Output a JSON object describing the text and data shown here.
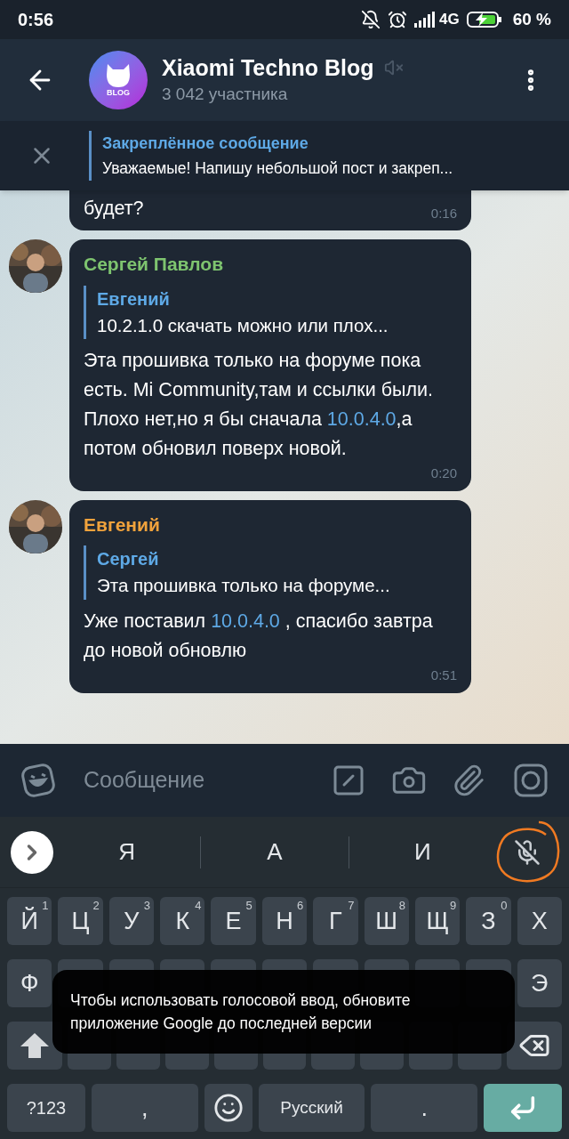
{
  "status_bar": {
    "time": "0:56",
    "network": "4G",
    "battery": "60 %",
    "charging": true
  },
  "header": {
    "title": "Xiaomi Techno Blog",
    "avatar_text": "BLOG",
    "muted": true,
    "subtitle": "3 042 участника"
  },
  "pinned": {
    "label": "Закреплённое сообщение",
    "text": "Уважаемые! Напишу небольшой пост и закреп..."
  },
  "messages": [
    {
      "kind": "cut",
      "body": [
        {
          "text": "будет?",
          "link": false
        }
      ],
      "time": "0:16"
    },
    {
      "kind": "reply",
      "sender": "Сергей Павлов",
      "color": "#7ec46f",
      "reply": {
        "author": "Евгений",
        "text": "10.2.1.0 скачать можно или плох..."
      },
      "body": [
        {
          "text": "Эта прошивка только на форуме пока есть. Mi Community,там и ссылки были. Плохо нет,но я бы сначала ",
          "link": false
        },
        {
          "text": "10.0.4.0",
          "link": true
        },
        {
          "text": ",а потом обновил поверх новой.",
          "link": false
        }
      ],
      "time": "0:20"
    },
    {
      "kind": "reply",
      "sender": "Евгений",
      "color": "#f0a23c",
      "reply": {
        "author": "Сергей",
        "text": "Эта прошивка только на форуме..."
      },
      "body": [
        {
          "text": "Уже поставил ",
          "link": false
        },
        {
          "text": "10.0.4.0",
          "link": true
        },
        {
          "text": " , спасибо завтра до новой обновлю",
          "link": false
        }
      ],
      "time": "0:51"
    }
  ],
  "composer": {
    "placeholder": "Сообщение"
  },
  "suggestions": [
    "Я",
    "А",
    "И"
  ],
  "voice_disabled": true,
  "keyboard_rows": [
    [
      {
        "kind": "letter",
        "label": "Й",
        "hint": "1"
      },
      {
        "kind": "letter",
        "label": "Ц",
        "hint": "2"
      },
      {
        "kind": "letter",
        "label": "У",
        "hint": "3"
      },
      {
        "kind": "letter",
        "label": "К",
        "hint": "4"
      },
      {
        "kind": "letter",
        "label": "Е",
        "hint": "5"
      },
      {
        "kind": "letter",
        "label": "Н",
        "hint": "6"
      },
      {
        "kind": "letter",
        "label": "Г",
        "hint": "7"
      },
      {
        "kind": "letter",
        "label": "Ш",
        "hint": "8"
      },
      {
        "kind": "letter",
        "label": "Щ",
        "hint": "9"
      },
      {
        "kind": "letter",
        "label": "З",
        "hint": "0"
      },
      {
        "kind": "letter",
        "label": "Х"
      }
    ],
    [
      {
        "kind": "letter",
        "label": "Ф"
      },
      {
        "kind": "blank"
      },
      {
        "kind": "blank"
      },
      {
        "kind": "blank"
      },
      {
        "kind": "blank"
      },
      {
        "kind": "blank"
      },
      {
        "kind": "blank"
      },
      {
        "kind": "blank"
      },
      {
        "kind": "blank"
      },
      {
        "kind": "blank"
      },
      {
        "kind": "letter",
        "label": "Э"
      }
    ],
    [
      {
        "kind": "shift"
      },
      {
        "kind": "blank"
      },
      {
        "kind": "blank"
      },
      {
        "kind": "blank"
      },
      {
        "kind": "blank"
      },
      {
        "kind": "blank"
      },
      {
        "kind": "blank"
      },
      {
        "kind": "blank"
      },
      {
        "kind": "blank"
      },
      {
        "kind": "blank"
      },
      {
        "kind": "backspace"
      }
    ],
    [
      {
        "kind": "symbols",
        "label": "?123"
      },
      {
        "kind": "letter",
        "label": ","
      },
      {
        "kind": "emoji"
      },
      {
        "kind": "space",
        "label": "Русский"
      },
      {
        "kind": "letter",
        "label": "."
      },
      {
        "kind": "enter"
      }
    ]
  ],
  "toast": "Чтобы использовать голосовой ввод, обновите приложение Google до последней версии"
}
